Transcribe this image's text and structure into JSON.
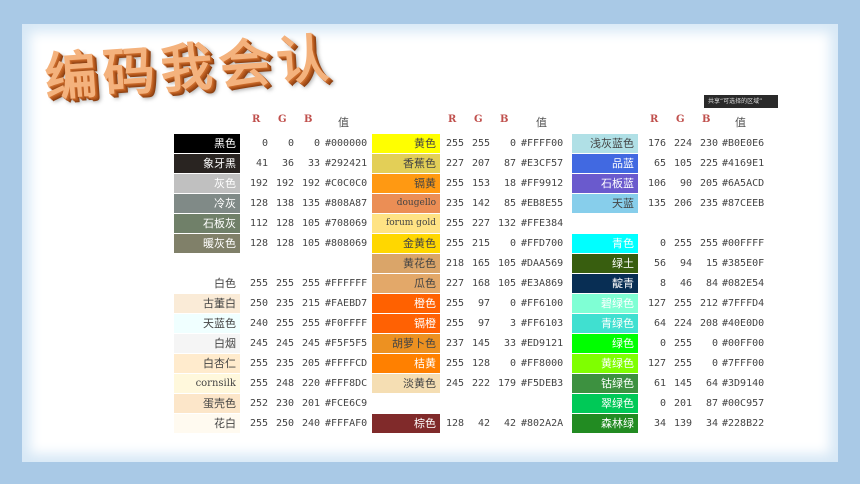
{
  "title": "编码我会认",
  "share_text": "共享“可选择的区域”",
  "headers": {
    "r": "R",
    "g": "G",
    "b": "B",
    "val": "值"
  },
  "panels": [
    {
      "rows": [
        {
          "name": "黑色",
          "r": "0",
          "g": "0",
          "b": "0",
          "hex": "#000000",
          "color": "#000000",
          "text": "#ffffff"
        },
        {
          "name": "象牙黑",
          "r": "41",
          "g": "36",
          "b": "33",
          "hex": "#292421",
          "color": "#292421",
          "text": "#ffffff"
        },
        {
          "name": "灰色",
          "r": "192",
          "g": "192",
          "b": "192",
          "hex": "#C0C0C0",
          "color": "#c0c0c0",
          "text": "#ffffff"
        },
        {
          "name": "冷灰",
          "r": "128",
          "g": "138",
          "b": "135",
          "hex": "#808A87",
          "color": "#808a87",
          "text": "#ffffff"
        },
        {
          "name": "石板灰",
          "r": "112",
          "g": "128",
          "b": "105",
          "hex": "#708069",
          "color": "#708069",
          "text": "#ffffff"
        },
        {
          "name": "暖灰色",
          "r": "128",
          "g": "128",
          "b": "105",
          "hex": "#808069",
          "color": "#808069",
          "text": "#ffffff"
        },
        {
          "name": "",
          "r": "",
          "g": "",
          "b": "",
          "hex": "",
          "color": "transparent",
          "text": "#444"
        },
        {
          "name": "白色",
          "r": "255",
          "g": "255",
          "b": "255",
          "hex": "#FFFFFF",
          "color": "#ffffff",
          "text": "#444444"
        },
        {
          "name": "古董白",
          "r": "250",
          "g": "235",
          "b": "215",
          "hex": "#FAEBD7",
          "color": "#faebd7",
          "text": "#444444"
        },
        {
          "name": "天蓝色",
          "r": "240",
          "g": "255",
          "b": "255",
          "hex": "#F0FFFF",
          "color": "#f0ffff",
          "text": "#444444"
        },
        {
          "name": "白烟",
          "r": "245",
          "g": "245",
          "b": "245",
          "hex": "#F5F5F5",
          "color": "#f5f5f5",
          "text": "#444444"
        },
        {
          "name": "白杏仁",
          "r": "255",
          "g": "235",
          "b": "205",
          "hex": "#FFFFCD",
          "color": "#ffebcd",
          "text": "#444444"
        },
        {
          "name": "cornsilk",
          "r": "255",
          "g": "248",
          "b": "220",
          "hex": "#FFF8DC",
          "color": "#fff8dc",
          "text": "#444444"
        },
        {
          "name": "蛋壳色",
          "r": "252",
          "g": "230",
          "b": "201",
          "hex": "#FCE6C9",
          "color": "#fce6c9",
          "text": "#444444"
        },
        {
          "name": "花白",
          "r": "255",
          "g": "250",
          "b": "240",
          "hex": "#FFFAF0",
          "color": "#fffaf0",
          "text": "#444444"
        }
      ]
    },
    {
      "rows": [
        {
          "name": "黄色",
          "r": "255",
          "g": "255",
          "b": "0",
          "hex": "#FFFF00",
          "color": "#ffff00",
          "text": "#444444"
        },
        {
          "name": "香蕉色",
          "r": "227",
          "g": "207",
          "b": "87",
          "hex": "#E3CF57",
          "color": "#e3cf57",
          "text": "#444444"
        },
        {
          "name": "镉黄",
          "r": "255",
          "g": "153",
          "b": "18",
          "hex": "#FF9912",
          "color": "#ff9912",
          "text": "#444444"
        },
        {
          "name": "dougello",
          "r": "235",
          "g": "142",
          "b": "85",
          "hex": "#EB8E55",
          "color": "#eb8e55",
          "text": "#444444"
        },
        {
          "name": "forum gold",
          "r": "255",
          "g": "227",
          "b": "132",
          "hex": "#FFE384",
          "color": "#ffe384",
          "text": "#444444"
        },
        {
          "name": "金黄色",
          "r": "255",
          "g": "215",
          "b": "0",
          "hex": "#FFD700",
          "color": "#ffd700",
          "text": "#444444"
        },
        {
          "name": "黄花色",
          "r": "218",
          "g": "165",
          "b": "105",
          "hex": "#DAA569",
          "color": "#daa569",
          "text": "#444444"
        },
        {
          "name": "瓜色",
          "r": "227",
          "g": "168",
          "b": "105",
          "hex": "#E3A869",
          "color": "#e3a869",
          "text": "#444444"
        },
        {
          "name": "橙色",
          "r": "255",
          "g": "97",
          "b": "0",
          "hex": "#FF6100",
          "color": "#ff6100",
          "text": "#ffffff"
        },
        {
          "name": "镉橙",
          "r": "255",
          "g": "97",
          "b": "3",
          "hex": "#FF6103",
          "color": "#ff6103",
          "text": "#ffffff"
        },
        {
          "name": "胡萝卜色",
          "r": "237",
          "g": "145",
          "b": "33",
          "hex": "#ED9121",
          "color": "#ed9121",
          "text": "#444444"
        },
        {
          "name": "桔黄",
          "r": "255",
          "g": "128",
          "b": "0",
          "hex": "#FF8000",
          "color": "#ff8000",
          "text": "#ffffff"
        },
        {
          "name": "淡黄色",
          "r": "245",
          "g": "222",
          "b": "179",
          "hex": "#F5DEB3",
          "color": "#f5deb3",
          "text": "#444444"
        },
        {
          "name": "",
          "r": "",
          "g": "",
          "b": "",
          "hex": "",
          "color": "transparent",
          "text": "#444"
        },
        {
          "name": "棕色",
          "r": "128",
          "g": "42",
          "b": "42",
          "hex": "#802A2A",
          "color": "#802a2a",
          "text": "#ffffff"
        }
      ]
    },
    {
      "rows": [
        {
          "name": "浅灰蓝色",
          "r": "176",
          "g": "224",
          "b": "230",
          "hex": "#B0E0E6",
          "color": "#b0e0e6",
          "text": "#444444"
        },
        {
          "name": "品蓝",
          "r": "65",
          "g": "105",
          "b": "225",
          "hex": "#4169E1",
          "color": "#4169e1",
          "text": "#ffffff"
        },
        {
          "name": "石板蓝",
          "r": "106",
          "g": "90",
          "b": "205",
          "hex": "#6A5ACD",
          "color": "#6a5acd",
          "text": "#ffffff"
        },
        {
          "name": "天蓝",
          "r": "135",
          "g": "206",
          "b": "235",
          "hex": "#87CEEB",
          "color": "#87ceeb",
          "text": "#444444"
        },
        {
          "name": "",
          "r": "",
          "g": "",
          "b": "",
          "hex": "",
          "color": "transparent",
          "text": "#444"
        },
        {
          "name": "青色",
          "r": "0",
          "g": "255",
          "b": "255",
          "hex": "#00FFFF",
          "color": "#00ffff",
          "text": "#ffffff"
        },
        {
          "name": "绿土",
          "r": "56",
          "g": "94",
          "b": "15",
          "hex": "#385E0F",
          "color": "#385e0f",
          "text": "#ffffff"
        },
        {
          "name": "靛青",
          "r": "8",
          "g": "46",
          "b": "84",
          "hex": "#082E54",
          "color": "#082e54",
          "text": "#ffffff"
        },
        {
          "name": "碧绿色",
          "r": "127",
          "g": "255",
          "b": "212",
          "hex": "#7FFFD4",
          "color": "#7fffd4",
          "text": "#ffffff"
        },
        {
          "name": "青绿色",
          "r": "64",
          "g": "224",
          "b": "208",
          "hex": "#40E0D0",
          "color": "#40e0d0",
          "text": "#ffffff"
        },
        {
          "name": "绿色",
          "r": "0",
          "g": "255",
          "b": "0",
          "hex": "#00FF00",
          "color": "#00ff00",
          "text": "#ffffff"
        },
        {
          "name": "黄绿色",
          "r": "127",
          "g": "255",
          "b": "0",
          "hex": "#7FFF00",
          "color": "#7fff00",
          "text": "#ffffff"
        },
        {
          "name": "钴绿色",
          "r": "61",
          "g": "145",
          "b": "64",
          "hex": "#3D9140",
          "color": "#3d9140",
          "text": "#ffffff"
        },
        {
          "name": "翠绿色",
          "r": "0",
          "g": "201",
          "b": "87",
          "hex": "#00C957",
          "color": "#00c957",
          "text": "#ffffff"
        },
        {
          "name": "森林绿",
          "r": "34",
          "g": "139",
          "b": "34",
          "hex": "#228B22",
          "color": "#228b22",
          "text": "#ffffff"
        }
      ]
    }
  ]
}
